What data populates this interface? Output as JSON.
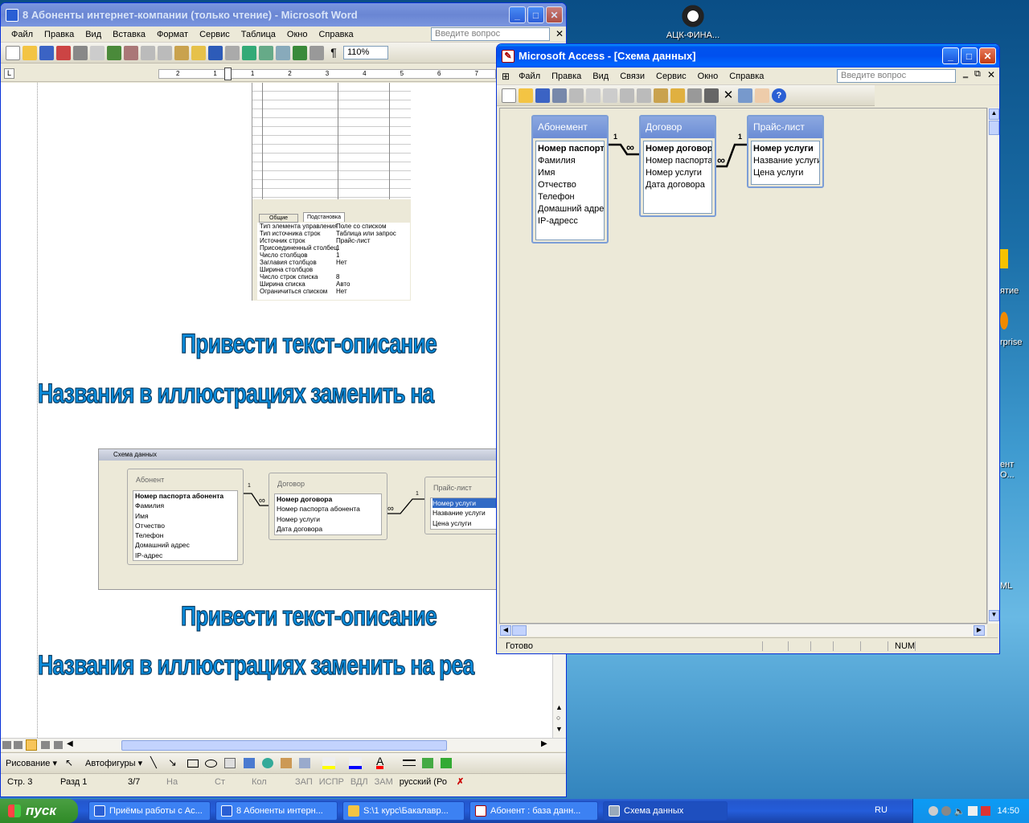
{
  "desktop": {
    "icon_label": "АЦК-ФИНА...",
    "side_texts": [
      "ятие",
      "rprise",
      "ент",
      "O...",
      "ML"
    ]
  },
  "word": {
    "title": "8 Абоненты интернет-компании  (только чтение) - Microsoft Word",
    "menu": [
      "Файл",
      "Правка",
      "Вид",
      "Вставка",
      "Формат",
      "Сервис",
      "Таблица",
      "Окно",
      "Справка"
    ],
    "question_placeholder": "Введите вопрос",
    "zoom": "110%",
    "ruler_nums": [
      "2",
      "1",
      "1",
      "2",
      "3",
      "4",
      "5",
      "6",
      "7"
    ],
    "props_tabs": [
      "Общие",
      "Подстановка"
    ],
    "props": [
      [
        "Тип элемента управления",
        "Поле со списком"
      ],
      [
        "Тип источника строк",
        "Таблица или запрос"
      ],
      [
        "Источник строк",
        "Прайс-лист"
      ],
      [
        "Присоединенный столбец",
        "1"
      ],
      [
        "Число столбцов",
        "1"
      ],
      [
        "Заглавия столбцов",
        "Нет"
      ],
      [
        "Ширина столбцов",
        ""
      ],
      [
        "Число строк списка",
        "8"
      ],
      [
        "Ширина списка",
        "Авто"
      ],
      [
        "Ограничиться списком",
        "Нет"
      ]
    ],
    "heading1": "Привести текст-описание",
    "heading2": "Названия в иллюстрациях заменить на",
    "heading3": "Привести текст-описание",
    "heading4": "Названия в иллюстрациях заменить на реа",
    "schema_img": {
      "title": "Схема данных",
      "t1": {
        "name": "Абонент",
        "fields": [
          "Номер паспорта абонента",
          "Фамилия",
          "Имя",
          "Отчество",
          "Телефон",
          "Домашний адрес",
          "IP-адрес"
        ]
      },
      "t2": {
        "name": "Договор",
        "fields": [
          "Номер договора",
          "Номер паспорта абонента",
          "Номер услуги",
          "Дата договора"
        ]
      },
      "t3": {
        "name": "Прайс-лист",
        "fields": [
          "Номер услуги",
          "Название услуги",
          "Цена услуги"
        ]
      },
      "one": "1",
      "many": "∞"
    },
    "drawing": {
      "draw": "Рисование ▾",
      "autoshapes": "Автофигуры ▾"
    },
    "status": [
      "Стр. 3",
      "Разд  1",
      "3/7",
      "На",
      "Ст",
      "Кол",
      "ЗАП",
      "ИСПР",
      "ВДЛ",
      "ЗАМ",
      "русский (Ро"
    ]
  },
  "access": {
    "title": "Microsoft Access - [Схема данных]",
    "menu": [
      "Файл",
      "Правка",
      "Вид",
      "Связи",
      "Сервис",
      "Окно",
      "Справка"
    ],
    "question_placeholder": "Введите вопрос",
    "tables": {
      "t1": {
        "name": "Абонемент",
        "fields": [
          "Номер паспорта",
          "Фамилия",
          "Имя",
          "Отчество",
          "Телефон",
          "Домашний адрес",
          "IP-адресс"
        ]
      },
      "t2": {
        "name": "Договор",
        "fields": [
          "Номер договора",
          "Номер паспорта",
          "Номер услуги",
          "Дата договора"
        ]
      },
      "t3": {
        "name": "Прайс-лист",
        "fields": [
          "Номер услуги",
          "Название услуги",
          "Цена услуги"
        ]
      }
    },
    "one": "1",
    "many": "∞",
    "status_left": "Готово",
    "status_num": "NUM"
  },
  "taskbar": {
    "start": "пуск",
    "tasks": [
      "Приёмы работы с Ас...",
      "8 Абоненты интерн...",
      "S:\\1 курс\\Бакалавр...",
      "Абонент : база данн...",
      "Схема данных"
    ],
    "lang": "RU",
    "clock": "14:50"
  }
}
